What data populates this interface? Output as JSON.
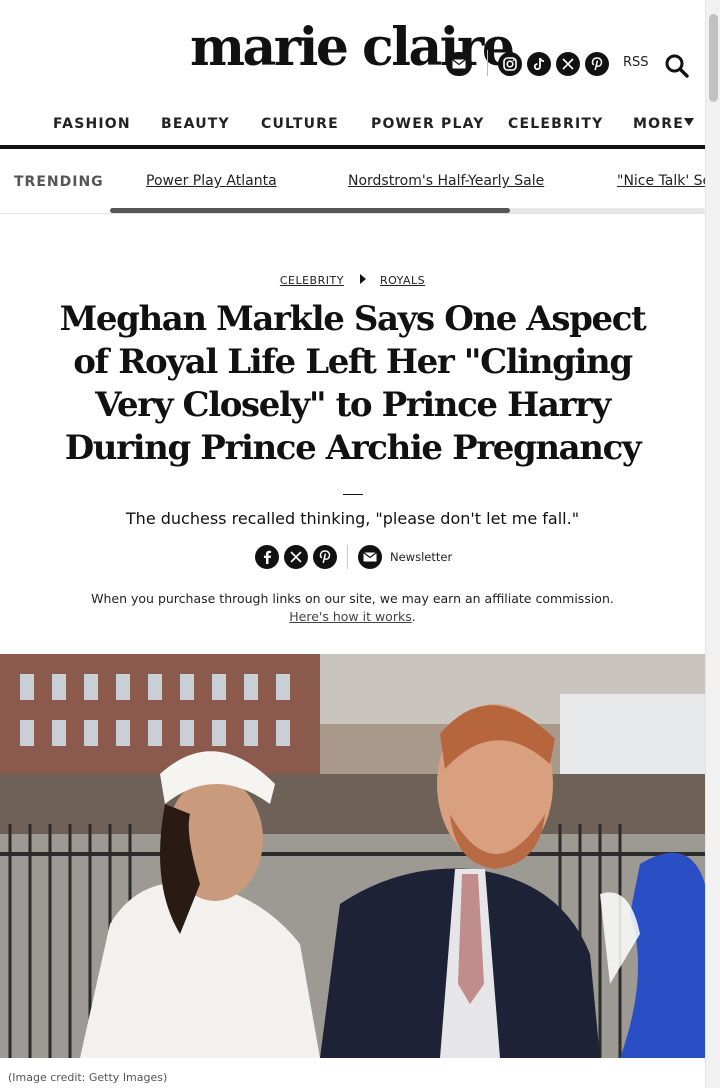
{
  "brand": {
    "logo_text": "marie claire"
  },
  "header": {
    "social_icons": [
      "instagram-icon",
      "tiktok-icon",
      "x-icon",
      "pinterest-icon"
    ],
    "rss_label": "RSS"
  },
  "nav": {
    "items": [
      {
        "label": "FASHION"
      },
      {
        "label": "BEAUTY"
      },
      {
        "label": "CULTURE"
      },
      {
        "label": "POWER PLAY"
      },
      {
        "label": "CELEBRITY"
      },
      {
        "label": "MORE"
      }
    ]
  },
  "trending": {
    "label": "TRENDING",
    "links": [
      {
        "label": "Power Play Atlanta"
      },
      {
        "label": "Nordstrom's Half-Yearly Sale"
      },
      {
        "label": "\"Nice Talk' Se"
      }
    ]
  },
  "article": {
    "breadcrumb": [
      "CELEBRITY",
      "ROYALS"
    ],
    "headline": "Meghan Markle Says One Aspect of Royal Life Left Her \"Clinging Very Closely\" to Prince Harry During Prince Archie Pregnancy",
    "dek": "The duchess recalled thinking, \"please don't let me fall.\"",
    "share_icons": [
      "facebook-icon",
      "x-icon",
      "pinterest-icon"
    ],
    "newsletter_label": "Newsletter",
    "affiliate_text": "When you purchase through links on our site, we may earn an affiliate commission. ",
    "affiliate_link": "Here's how it works",
    "affiliate_end": ".",
    "image_credit": "(Image credit: Getty Images)"
  },
  "colors": {
    "text": "#111111",
    "rule": "#111111",
    "muted": "#555555"
  }
}
